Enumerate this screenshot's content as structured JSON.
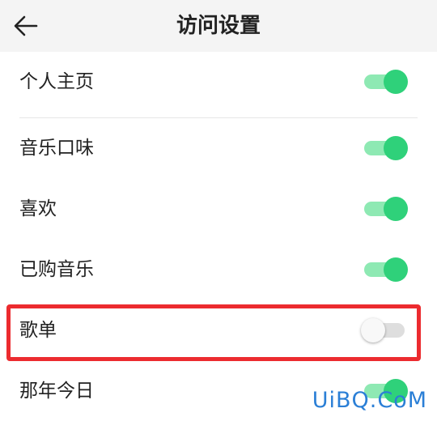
{
  "header": {
    "title": "访问设置",
    "back_icon": "arrow-left-icon"
  },
  "settings": [
    {
      "label": "个人主页",
      "enabled": true
    },
    {
      "label": "音乐口味",
      "enabled": true
    },
    {
      "label": "喜欢",
      "enabled": true
    },
    {
      "label": "已购音乐",
      "enabled": true
    },
    {
      "label": "歌单",
      "enabled": false
    },
    {
      "label": "那年今日",
      "enabled": true
    }
  ],
  "watermark": "UiBQ.CoM",
  "colors": {
    "toggle_on_knob": "#2fd17a",
    "toggle_on_track": "#8ee9b3",
    "toggle_off_track": "#dedede",
    "highlight_border": "#ec2b2f",
    "watermark": "#2b7fd6"
  }
}
